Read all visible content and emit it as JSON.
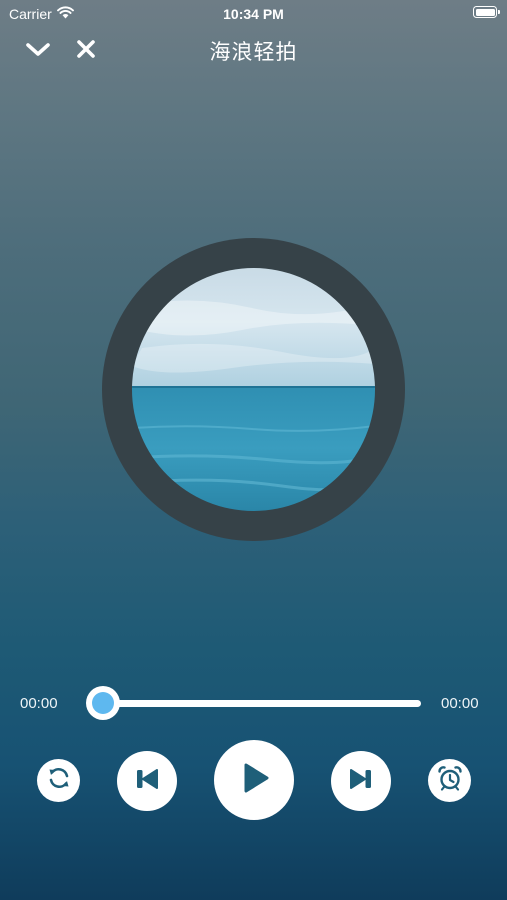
{
  "status_bar": {
    "carrier": "Carrier",
    "time": "10:34 PM"
  },
  "nav": {
    "title": "海浪轻拍"
  },
  "player": {
    "elapsed": "00:00",
    "duration": "00:00",
    "progress": 0
  },
  "icons": {
    "collapse": "chevron-down-icon",
    "close": "close-icon",
    "repeat": "repeat-icon",
    "previous": "skip-previous-icon",
    "play": "play-icon",
    "next": "skip-next-icon",
    "timer": "alarm-clock-icon"
  },
  "colors": {
    "accent": "#5eb8ef",
    "icon": "#1f5f79",
    "disc_ring": "#364248"
  }
}
